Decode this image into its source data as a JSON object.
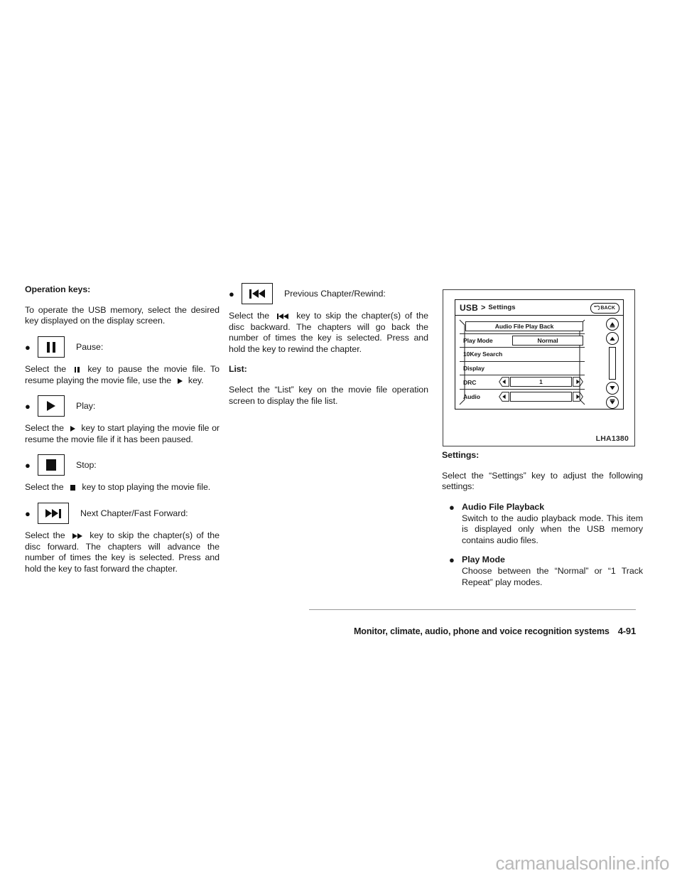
{
  "left_column": {
    "heading": "Operation keys:",
    "intro": "To operate the USB memory, select the desired key displayed on the display screen.",
    "items": [
      {
        "icon": "pause-icon",
        "label": "Pause:",
        "text_before": "Select the",
        "inline_icon_1": "pause-icon",
        "text_mid": "key to pause the movie file. To resume playing the movie file, use the",
        "inline_icon_2": "play-icon",
        "text_after": "key."
      },
      {
        "icon": "play-icon",
        "label": "Play:",
        "text_before": "Select the",
        "inline_icon_1": "play-icon",
        "text_after": "key to start playing the movie file or resume the movie file if it has been paused."
      },
      {
        "icon": "stop-icon",
        "label": "Stop:",
        "text_before": "Select the",
        "inline_icon_1": "stop-icon",
        "text_after": "key to stop playing the movie file."
      },
      {
        "icon": "next-chapter-icon",
        "label": "Next Chapter/Fast Forward:",
        "text_before": "Select the",
        "inline_icon_1": "fast-forward-icon",
        "text_after": "key to skip the chapter(s) of the disc forward. The chapters will advance the number of times the key is selected. Press and hold the key to fast forward the chapter."
      }
    ]
  },
  "middle_column": {
    "item": {
      "icon": "previous-chapter-icon",
      "label": "Previous Chapter/Rewind:",
      "text_before": "Select the",
      "inline_icon_1": "rewind-icon",
      "text_after": "key to skip the chapter(s) of the disc backward. The chapters will go back the number of times the key is selected. Press and hold the key to rewind the chapter."
    },
    "list_heading": "List:",
    "list_text": "Select the “List” key on the movie file operation screen to display the file list."
  },
  "figure": {
    "code": "LHA1380",
    "screen": {
      "breadcrumb_root": "USB",
      "breadcrumb_separator": ">",
      "breadcrumb_current": "Settings",
      "back_button_label": "BACK",
      "rows": [
        {
          "type": "full-pill",
          "label": "Audio File Play Back"
        },
        {
          "type": "label-pill",
          "label": "Play Mode",
          "value": "Normal"
        },
        {
          "type": "label-only",
          "label": "10Key Search"
        },
        {
          "type": "label-only",
          "label": "Display"
        },
        {
          "type": "stepper",
          "label": "DRC",
          "value": "1"
        },
        {
          "type": "stepper",
          "label": "Audio",
          "value": ""
        }
      ],
      "scroll_controls": [
        "scroll-top-icon",
        "scroll-up-icon",
        "scroll-track",
        "scroll-down-icon",
        "scroll-bottom-icon"
      ]
    }
  },
  "right_column": {
    "heading": "Settings:",
    "intro": "Select the “Settings” key to adjust the following settings:",
    "bullets": [
      {
        "title": "Audio File Playback",
        "text": "Switch to the audio playback mode. This item is displayed only when the USB memory contains audio files."
      },
      {
        "title": "Play Mode",
        "text": "Choose between the “Normal” or “1 Track Repeat” play modes."
      }
    ]
  },
  "footer": {
    "title": "Monitor, climate, audio, phone and voice recognition systems",
    "page": "4-91"
  },
  "watermark": "carmanualsonline.info",
  "colors": {
    "text": "#1a1a1a",
    "rule": "#9a9a9a",
    "watermark": "#b9b9b9",
    "figure_border": "#3a3a3a",
    "screen_border": "#111111"
  }
}
